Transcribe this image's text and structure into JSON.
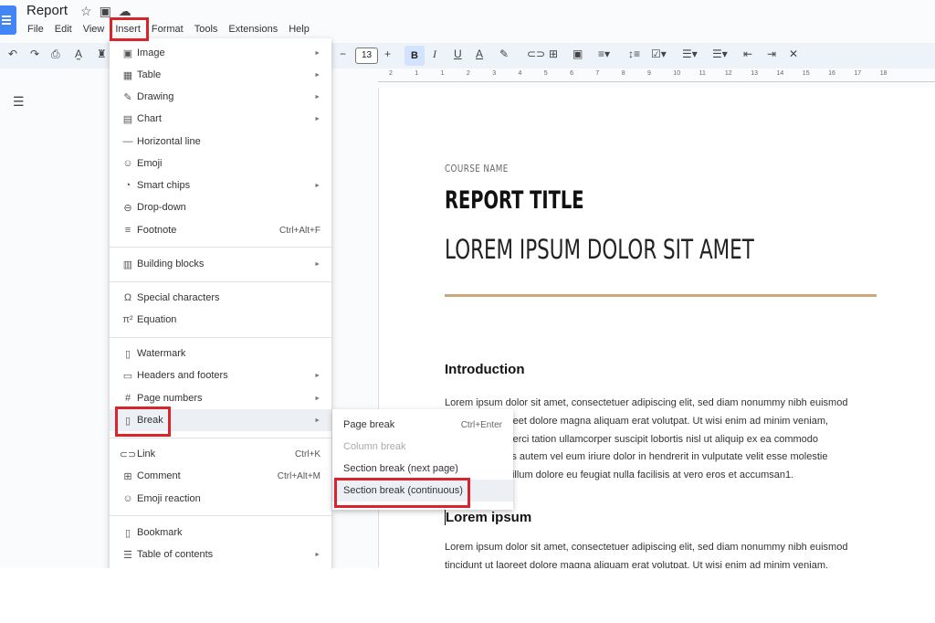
{
  "app": {
    "title": "Report"
  },
  "menubar": [
    "File",
    "Edit",
    "View",
    "Insert",
    "Format",
    "Tools",
    "Extensions",
    "Help"
  ],
  "toolbar": {
    "font_size": "13",
    "ruler_ticks": [
      "2",
      "1",
      "1",
      "2",
      "3",
      "4",
      "5",
      "6",
      "7",
      "8",
      "9",
      "10",
      "11",
      "12",
      "13",
      "14",
      "15",
      "16",
      "17",
      "18"
    ]
  },
  "insert_menu": {
    "groups": [
      [
        {
          "icon": "image-icon",
          "glyph": "▣",
          "label": "Image",
          "submenu": true
        },
        {
          "icon": "table-icon",
          "glyph": "▦",
          "label": "Table",
          "submenu": true
        },
        {
          "icon": "drawing-icon",
          "glyph": "✎",
          "label": "Drawing",
          "submenu": true
        },
        {
          "icon": "chart-icon",
          "glyph": "▤",
          "label": "Chart",
          "submenu": true
        },
        {
          "icon": "horizontal-line-icon",
          "glyph": "—",
          "label": "Horizontal line"
        },
        {
          "icon": "emoji-icon",
          "glyph": "☺",
          "label": "Emoji"
        },
        {
          "icon": "smart-chips-icon",
          "glyph": "◔",
          "label": "Smart chips",
          "submenu": true
        },
        {
          "icon": "dropdown-icon",
          "glyph": "⊖",
          "label": "Drop-down"
        },
        {
          "icon": "footnote-icon",
          "glyph": "≡",
          "label": "Footnote",
          "shortcut": "Ctrl+Alt+F"
        }
      ],
      [
        {
          "icon": "building-blocks-icon",
          "glyph": "▥",
          "label": "Building blocks",
          "submenu": true
        }
      ],
      [
        {
          "icon": "omega-icon",
          "glyph": "Ω",
          "label": "Special characters"
        },
        {
          "icon": "pi-icon",
          "glyph": "π²",
          "label": "Equation"
        }
      ],
      [
        {
          "icon": "watermark-icon",
          "glyph": "▯",
          "label": "Watermark"
        },
        {
          "icon": "headers-footers-icon",
          "glyph": "▭",
          "label": "Headers and footers",
          "submenu": true
        },
        {
          "icon": "page-numbers-icon",
          "glyph": "#",
          "label": "Page numbers",
          "submenu": true
        },
        {
          "icon": "break-icon",
          "glyph": "▯",
          "label": "Break",
          "submenu": true,
          "highlighted": true
        }
      ],
      [
        {
          "icon": "link-icon",
          "glyph": "⊂⊃",
          "label": "Link",
          "shortcut": "Ctrl+K"
        },
        {
          "icon": "comment-icon",
          "glyph": "⊞",
          "label": "Comment",
          "shortcut": "Ctrl+Alt+M"
        },
        {
          "icon": "emoji-reaction-icon",
          "glyph": "☺",
          "label": "Emoji reaction"
        }
      ],
      [
        {
          "icon": "bookmark-icon",
          "glyph": "▯",
          "label": "Bookmark"
        },
        {
          "icon": "toc-icon",
          "glyph": "☰",
          "label": "Table of contents",
          "submenu": true
        }
      ]
    ]
  },
  "break_submenu": [
    {
      "label": "Page break",
      "shortcut": "Ctrl+Enter"
    },
    {
      "label": "Column break",
      "disabled": true
    },
    {
      "label": "Section break (next page)"
    },
    {
      "label": "Section break (continuous)",
      "highlighted": true
    }
  ],
  "document": {
    "course": "COURSE NAME",
    "title": "REPORT TITLE",
    "subtitle": "LOREM IPSUM DOLOR SIT AMET",
    "heading1": "Introduction",
    "para1": [
      "Lorem ipsum dolor sit amet, consectetuer adipiscing elit, sed diam nonummy nibh euismod",
      "tincidunt ut laoreet dolore magna aliquam erat volutpat. Ut wisi enim ad minim veniam,",
      "quis nostrud exerci tation ullamcorper suscipit lobortis nisl ut aliquip ex ea commodo",
      "consequat. Duis autem vel eum iriure dolor in hendrerit in vulputate velit esse molestie",
      "consequat, vel illum dolore eu feugiat nulla facilisis at vero eros et accumsan1."
    ],
    "heading2": "Lorem ipsum",
    "para2": [
      "Lorem ipsum dolor sit amet, consectetuer adipiscing elit, sed diam nonummy nibh euismod",
      "tincidunt ut laoreet dolore magna aliquam erat volutpat. Ut wisi enim ad minim veniam,"
    ]
  },
  "colors": {
    "highlight_box": "#d9242b",
    "accent_rule": "#c9a97a",
    "bold_active": "#d3e3fd"
  }
}
